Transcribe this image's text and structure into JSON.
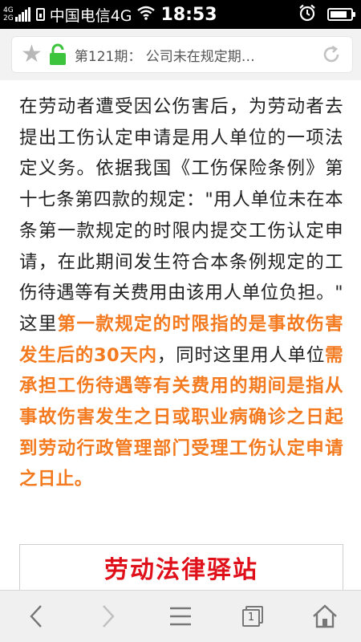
{
  "status_bar": {
    "network_top": "4G",
    "network_bottom": "2G",
    "carrier": "中国电信4G",
    "time": "18:53",
    "battery_level_percent": 85
  },
  "address_bar": {
    "page_title": "第121期：  公司未在规定期…"
  },
  "article": {
    "segments": [
      {
        "text": "在劳动者遭受因公伤害后，为劳动者去提出工伤认定申请是用人单位的一项法定义务。依据我国《工伤保险条例》第十七条第四款的规定：\"用人单位未在本条第一款规定的时限内提交工伤认定申请，在此期间发生符合本条例规定的工伤待遇等有关费用由该用人单位负担。\" 这里",
        "highlight": false
      },
      {
        "text": "第一款规定的时限指的是事故伤害发生后的30天内",
        "highlight": true
      },
      {
        "text": "，同时这里用人单位",
        "highlight": false
      },
      {
        "text": "需承担工伤待遇等有关费用的期间是指从事故伤害发生之日或职业病确诊之日起到劳动行政管理部门受理工伤认定申请之日止。",
        "highlight": true
      }
    ]
  },
  "image_banner": {
    "title": "劳动法律驿站"
  },
  "toolbar": {
    "tab_count": "1"
  },
  "colors": {
    "highlight": "#f47a20",
    "banner_title": "#e0101a",
    "secure_lock": "#3cc43c"
  }
}
